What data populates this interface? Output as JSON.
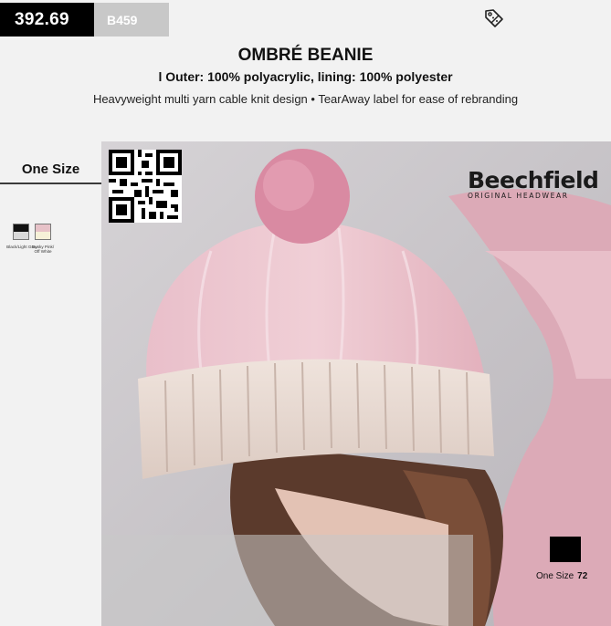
{
  "header": {
    "price": "392.69",
    "code": "B459",
    "tag_icon": "discount-tag-icon",
    "title": "OMBRÉ BEANIE",
    "material": "l Outer: 100% polyacrylic, lining: 100% polyester",
    "features": "Heavyweight multi yarn cable knit design • TearAway label for ease of rebranding"
  },
  "sidebar": {
    "size": "One Size",
    "swatches": [
      {
        "label": "Black/Light Grey",
        "top_color": "#111111",
        "bottom_color": "#d9d9d9"
      },
      {
        "label": "Dusky Pink/ Off White",
        "top_color": "#e7c2c8",
        "bottom_color": "#f6f1d8"
      }
    ]
  },
  "photo": {
    "brand_name": "Beechfield",
    "brand_tagline": "ORIGINAL HEADWEAR",
    "stock_size": "One Size",
    "stock_count": "72"
  },
  "colors": {
    "price_bg": "#000000",
    "code_bg": "#c8c8c8",
    "panel_bg": "#f2f2f2"
  }
}
